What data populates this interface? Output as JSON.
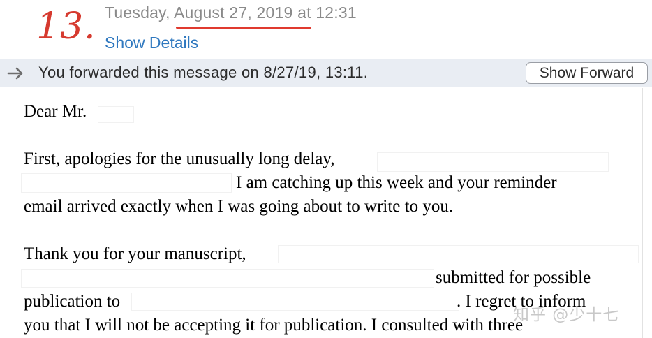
{
  "annotation": {
    "number": "13."
  },
  "header": {
    "date_prefix": "Tuesday, ",
    "date_highlight": "August 27, 2019",
    "date_suffix": " at 12:31",
    "details_link": "Show Details"
  },
  "forward_bar": {
    "message": "You forwarded this message on 8/27/19, 13:11.",
    "button": "Show Forward",
    "arrow_icon": "forward-arrow-icon"
  },
  "body_lines": {
    "salutation": "Dear Mr.",
    "p1_l1": "First, apologies for the unusually long delay,",
    "p1_l2": "I am catching up this week and your reminder",
    "p1_l3": "email arrived exactly when I was going about to write to you.",
    "p2_l1": "Thank you for your manuscript,",
    "p2_l2": "submitted for possible",
    "p2_l3a": "publication to",
    "p2_l3b": ". I regret to inform",
    "p2_l4": "you that I will not be accepting it for publication. I consulted with three"
  },
  "watermark": "知乎 @少十七",
  "colors": {
    "annotation_red": "#e03a2f",
    "link_blue": "#2f78bf",
    "bar_bg": "#e9edf3"
  }
}
